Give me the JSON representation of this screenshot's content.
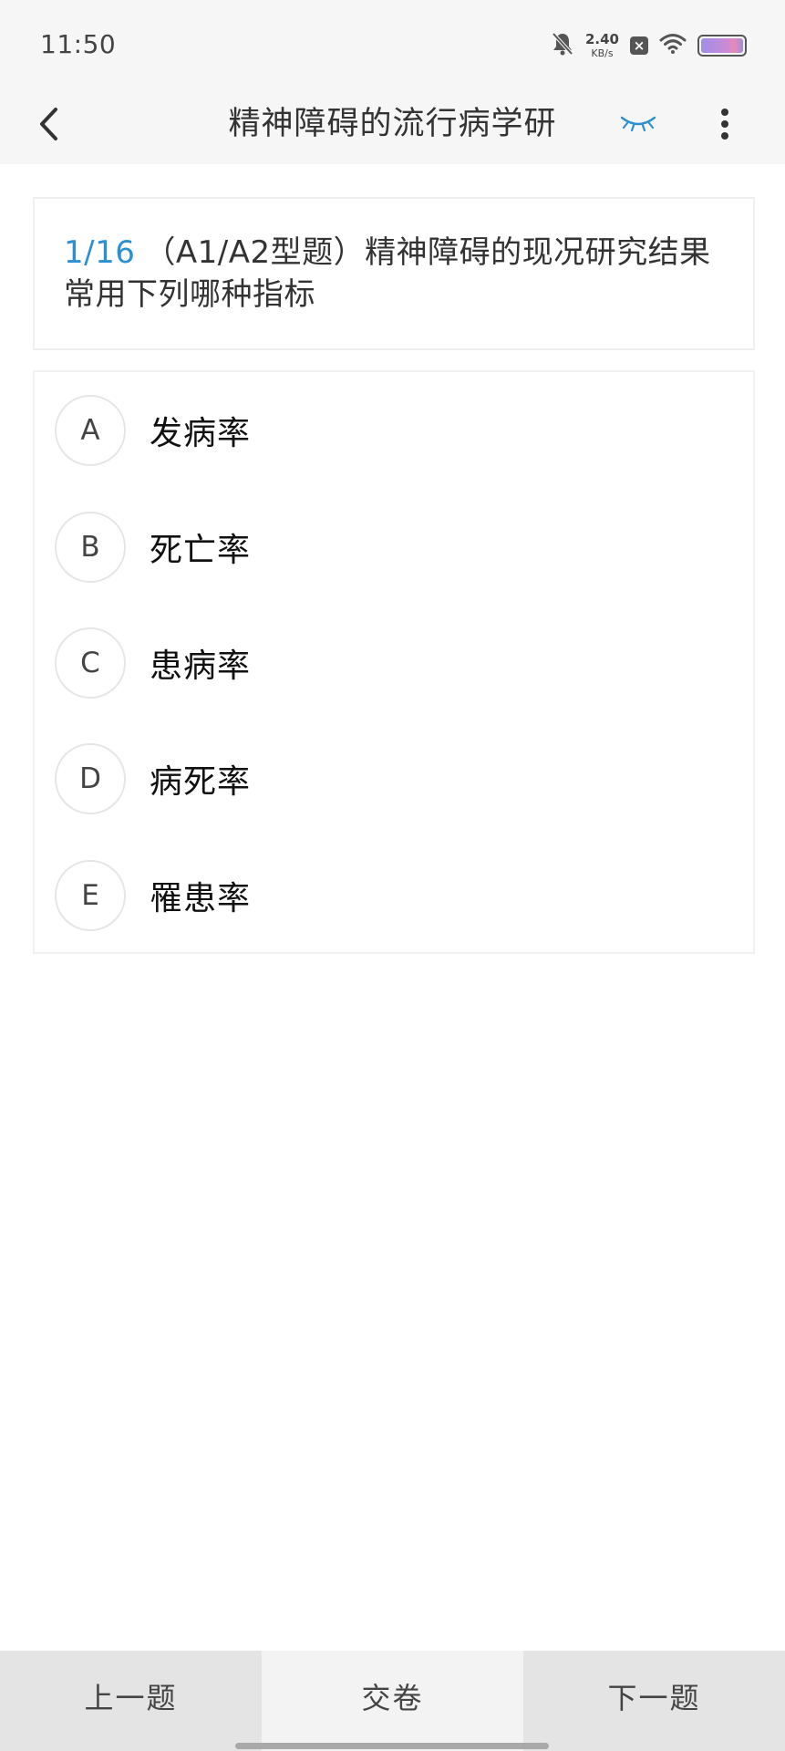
{
  "status_bar": {
    "time": "11:50",
    "net_speed_value": "2.40",
    "net_speed_unit": "KB/s",
    "icons": [
      "bell-muted-icon",
      "sim-x-icon",
      "wifi-icon",
      "battery-icon"
    ],
    "battery_colors": [
      "#9f8ee8",
      "#e889b7"
    ]
  },
  "app_bar": {
    "back_icon": "chevron-left-icon",
    "title": "精神障碍的流行病学研",
    "eye_icon": "eye-closed-icon",
    "more_icon": "more-vertical-icon",
    "accent_color": "#2b8fd3"
  },
  "question": {
    "number": "1/16",
    "text": "（A1/A2型题）精神障碍的现况研究结果常用下列哪种指标"
  },
  "options": [
    {
      "letter": "A",
      "text": "发病率"
    },
    {
      "letter": "B",
      "text": "死亡率"
    },
    {
      "letter": "C",
      "text": "患病率"
    },
    {
      "letter": "D",
      "text": "病死率"
    },
    {
      "letter": "E",
      "text": "罹患率"
    }
  ],
  "bottom_bar": {
    "prev_label": "上一题",
    "submit_label": "交卷",
    "next_label": "下一题"
  }
}
